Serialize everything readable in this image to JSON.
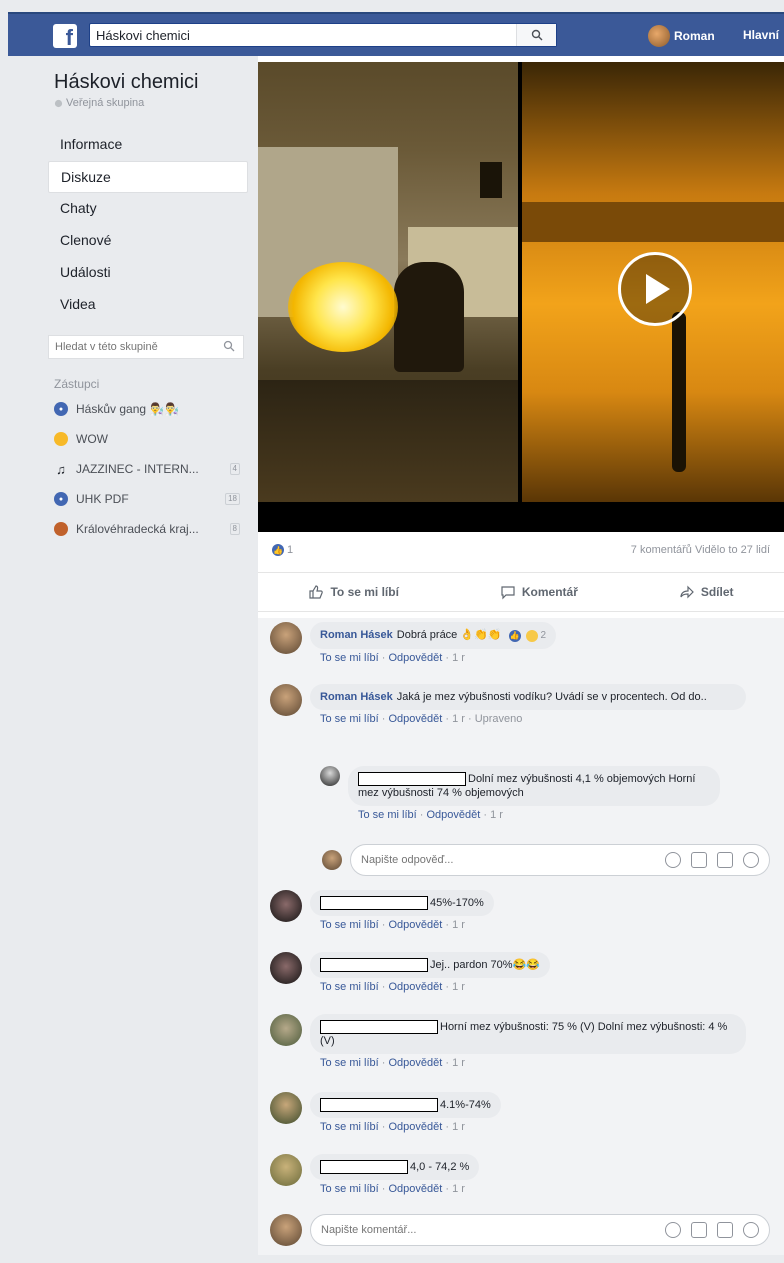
{
  "topbar": {
    "search_value": "Háskovi chemici",
    "user_name": "Roman",
    "home_label": "Hlavní"
  },
  "sidebar": {
    "group_title": "Háskovi chemici",
    "group_type": "Veřejná skupina",
    "nav": [
      {
        "label": "Informace"
      },
      {
        "label": "Diskuze"
      },
      {
        "label": "Chaty"
      },
      {
        "label": "Clenové"
      },
      {
        "label": "Události"
      },
      {
        "label": "Videa"
      }
    ],
    "search_placeholder": "Hledat v této skupině",
    "shortcuts_title": "Zástupci",
    "shortcuts": [
      {
        "label": "Háskův gang 👨‍🔬👨‍🔬",
        "badge": ""
      },
      {
        "label": "WOW",
        "badge": ""
      },
      {
        "label": "JAZZINEC - INTERN...",
        "badge": "4"
      },
      {
        "label": "UHK PDF",
        "badge": "18"
      },
      {
        "label": "Královéhradecká kraj...",
        "badge": "8"
      }
    ]
  },
  "post": {
    "likes": "1",
    "stats_right": "7 komentářů  Vidělo to 27 lidí",
    "like_label": "To se mi líbí",
    "comment_label": "Komentář",
    "share_label": "Sdílet"
  },
  "comments": [
    {
      "author": "Roman Hásek",
      "text": "Dobrá práce 👌👏👏",
      "react_count": "2",
      "like": "To se mi líbí",
      "reply": "Odpovědět",
      "time": "1 r",
      "edited": ""
    },
    {
      "author": "Roman Hásek",
      "text": "Jaká je mez výbušnosti vodíku? Uvádí se v procentech. Od do..",
      "like": "To se mi líbí",
      "reply": "Odpovědět",
      "time": "1 r",
      "edited": "Upraveno"
    },
    {
      "author": "",
      "text": "Dolní mez výbušnosti 4,1 % objemových Horní mez výbušnosti 74 % objemových",
      "like": "To se mi líbí",
      "reply": "Odpovědět",
      "time": "1 r"
    },
    {
      "author": "",
      "text": "45%-170%",
      "like": "To se mi líbí",
      "reply": "Odpovědět",
      "time": "1 r"
    },
    {
      "author": "",
      "text": "Jej.. pardon 70%😂😂",
      "like": "To se mi líbí",
      "reply": "Odpovědět",
      "time": "1 r"
    },
    {
      "author": "",
      "text": "Horní mez výbušnosti: 75 % (V) Dolní mez výbušnosti: 4 % (V)",
      "like": "To se mi líbí",
      "reply": "Odpovědět",
      "time": "1 r"
    },
    {
      "author": "",
      "text": "4.1%-74%",
      "like": "To se mi líbí",
      "reply": "Odpovědět",
      "time": "1 r"
    },
    {
      "author": "",
      "text": "4,0 - 74,2 %",
      "like": "To se mi líbí",
      "reply": "Odpovědět",
      "time": "1 r"
    }
  ],
  "reply_placeholder": "Napište odpověď...",
  "comment_placeholder": "Napište komentář...",
  "colors": {
    "brand": "#3b5998",
    "link": "#385898"
  }
}
